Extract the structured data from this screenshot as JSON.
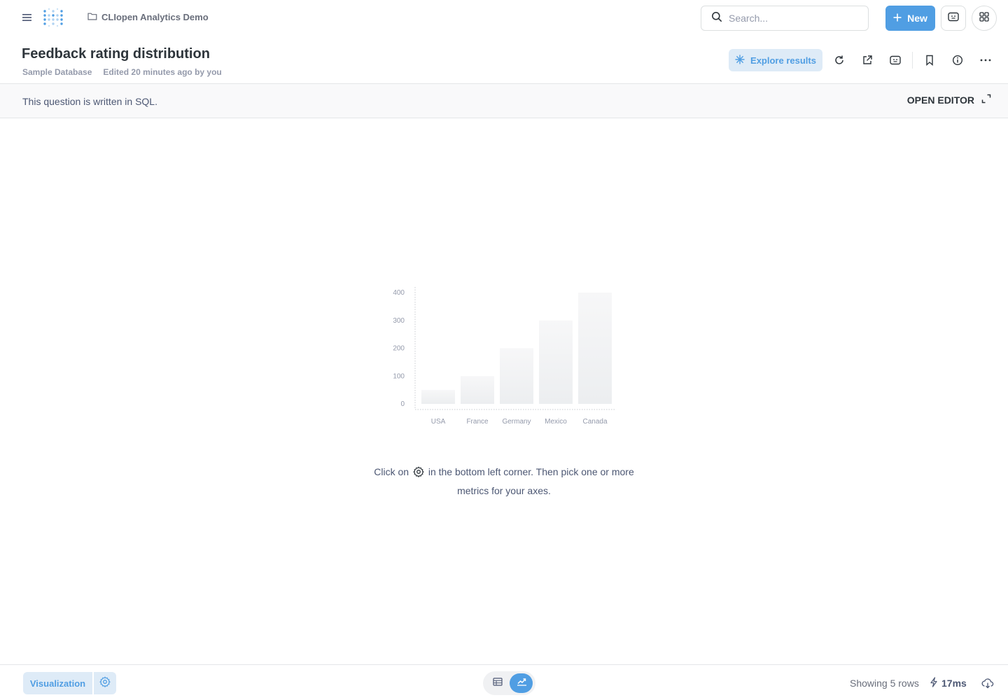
{
  "nav": {
    "collection": "CLIopen Analytics Demo",
    "search_placeholder": "Search...",
    "new_label": "New"
  },
  "header": {
    "title": "Feedback rating distribution",
    "database": "Sample Database",
    "edited": "Edited 20 minutes ago by you",
    "explore_label": "Explore results"
  },
  "banner": {
    "text": "This question is written in SQL.",
    "open_editor": "OPEN EDITOR"
  },
  "chart_data": {
    "type": "bar",
    "categories": [
      "USA",
      "France",
      "Germany",
      "Mexico",
      "Canada"
    ],
    "values": [
      50,
      100,
      200,
      300,
      400
    ],
    "yticks": [
      "0",
      "100",
      "200",
      "300",
      "400"
    ],
    "ylim": [
      0,
      400
    ],
    "title": "",
    "xlabel": "",
    "ylabel": ""
  },
  "helper": {
    "before": "Click on",
    "after": "in the bottom left corner. Then pick one or more metrics for your axes."
  },
  "footer": {
    "visualization": "Visualization",
    "rows": "Showing 5 rows",
    "timing": "17ms"
  },
  "colors": {
    "brand": "#509ee3",
    "brand_light": "#deebf7",
    "text_dark": "#2e353b",
    "placeholder_bar": "#eef0f2"
  }
}
